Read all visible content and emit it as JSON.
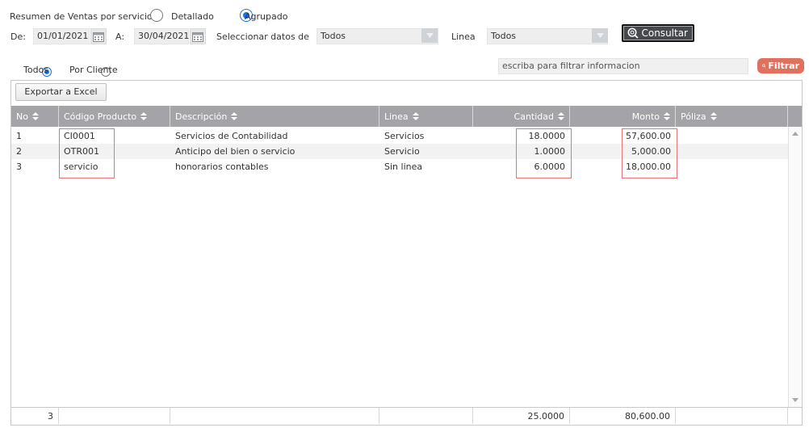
{
  "report": {
    "title_label": "Resumen de Ventas por servicio",
    "mode_options": [
      {
        "label": "Detallado",
        "selected": false
      },
      {
        "label": "Agrupado",
        "selected": true
      }
    ]
  },
  "filters": {
    "from_label": "De:",
    "from_value": "01/01/2021",
    "to_label": "A:",
    "to_value": "30/04/2021",
    "data_label": "Seleccionar datos de",
    "data_value": "Todos",
    "line_label": "Linea",
    "line_value": "Todos",
    "consult_label": "Consultar"
  },
  "scope": {
    "options": [
      {
        "label": "Todos",
        "selected": true
      },
      {
        "label": "Por Cliente",
        "selected": false
      }
    ]
  },
  "search": {
    "placeholder": "escriba para filtrar informacion",
    "filter_label": "Filtrar"
  },
  "grid": {
    "export_label": "Exportar a Excel",
    "columns": [
      "No",
      "Código Producto",
      "Descripción",
      "Linea",
      "Cantidad",
      "Monto",
      "Póliza"
    ],
    "rows": [
      {
        "no": "1",
        "code": "CI0001",
        "desc": "Servicios de Contabilidad",
        "line": "Servicios",
        "qty": "18.0000",
        "amount": "57,600.00",
        "policy": ""
      },
      {
        "no": "2",
        "code": "OTR001",
        "desc": "Anticipo del bien o servicio",
        "line": "Servicio",
        "qty": "1.0000",
        "amount": "5,000.00",
        "policy": ""
      },
      {
        "no": "3",
        "code": "servicio",
        "desc": "honorarios contables",
        "line": "Sin linea",
        "qty": "6.0000",
        "amount": "18,000.00",
        "policy": ""
      }
    ],
    "totals": {
      "no": "3",
      "qty": "25.0000",
      "amount": "80,600.00"
    }
  },
  "colors": {
    "header_bg": "#a3a3a8",
    "accent_blue": "#1a73e8",
    "filter_button": "#e0715e",
    "highlight_border": "#e57373"
  }
}
